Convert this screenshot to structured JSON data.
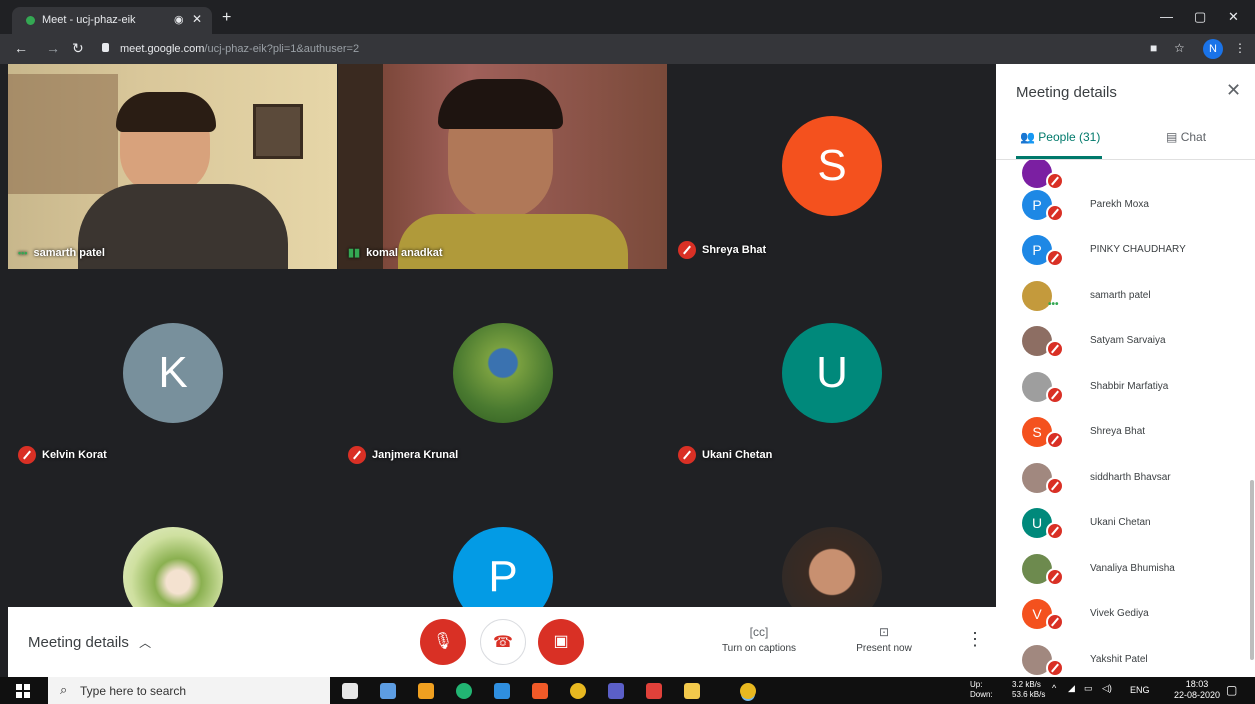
{
  "browser": {
    "tab_title": "Meet - ucj-phaz-eik",
    "url_host": "meet.google.com",
    "url_path": "/ucj-phaz-eik?pli=1&authuser=2",
    "profile_initial": "N"
  },
  "tiles": [
    {
      "name": "samarth patel"
    },
    {
      "name": "komal anadkat"
    },
    {
      "name": "Shreya Bhat",
      "initial": "S",
      "color": "#f4511e"
    },
    {
      "name": "Kelvin Korat",
      "initial": "K",
      "color": "#78909c"
    },
    {
      "name": "Janjmera Krunal"
    },
    {
      "name": "Ukani Chetan",
      "initial": "U",
      "color": "#00897b"
    },
    {
      "name": ""
    },
    {
      "name": "",
      "initial": "P",
      "color": "#039be5"
    },
    {
      "name": ""
    }
  ],
  "controls": {
    "meeting_details": "Meeting details",
    "captions": "Turn on captions",
    "present": "Present now"
  },
  "panel": {
    "title": "Meeting details",
    "people_tab": "People (31)",
    "chat_tab": "Chat",
    "people": [
      {
        "name": "",
        "initial": "",
        "color": "#7b1fa2",
        "state": "muted"
      },
      {
        "name": "Parekh Moxa",
        "initial": "P",
        "color": "#1e88e5",
        "state": "muted"
      },
      {
        "name": "PINKY CHAUDHARY",
        "initial": "P",
        "color": "#1e88e5",
        "state": "muted"
      },
      {
        "name": "samarth patel",
        "initial": "",
        "color": "#c49a3c",
        "state": "speaking"
      },
      {
        "name": "Satyam Sarvaiya",
        "initial": "",
        "color": "#8d6e63",
        "state": "muted"
      },
      {
        "name": "Shabbir Marfatiya",
        "initial": "",
        "color": "#9e9e9e",
        "state": "muted"
      },
      {
        "name": "Shreya Bhat",
        "initial": "S",
        "color": "#f4511e",
        "state": "muted"
      },
      {
        "name": "siddharth Bhavsar",
        "initial": "",
        "color": "#a1887f",
        "state": "muted"
      },
      {
        "name": "Ukani Chetan",
        "initial": "U",
        "color": "#00897b",
        "state": "muted"
      },
      {
        "name": "Vanaliya Bhumisha",
        "initial": "",
        "color": "#6d8a4e",
        "state": "muted"
      },
      {
        "name": "Vivek Gediya",
        "initial": "V",
        "color": "#f4511e",
        "state": "muted"
      },
      {
        "name": "Yakshit Patel",
        "initial": "",
        "color": "#a1887f",
        "state": "muted"
      }
    ]
  },
  "taskbar": {
    "search_placeholder": "Type here to search",
    "net_up_label": "Up:",
    "net_down_label": "Down:",
    "net_up": "3.2 kB/s",
    "net_down": "53.6 kB/s",
    "lang": "ENG",
    "time": "18:03",
    "date": "22-08-2020"
  }
}
